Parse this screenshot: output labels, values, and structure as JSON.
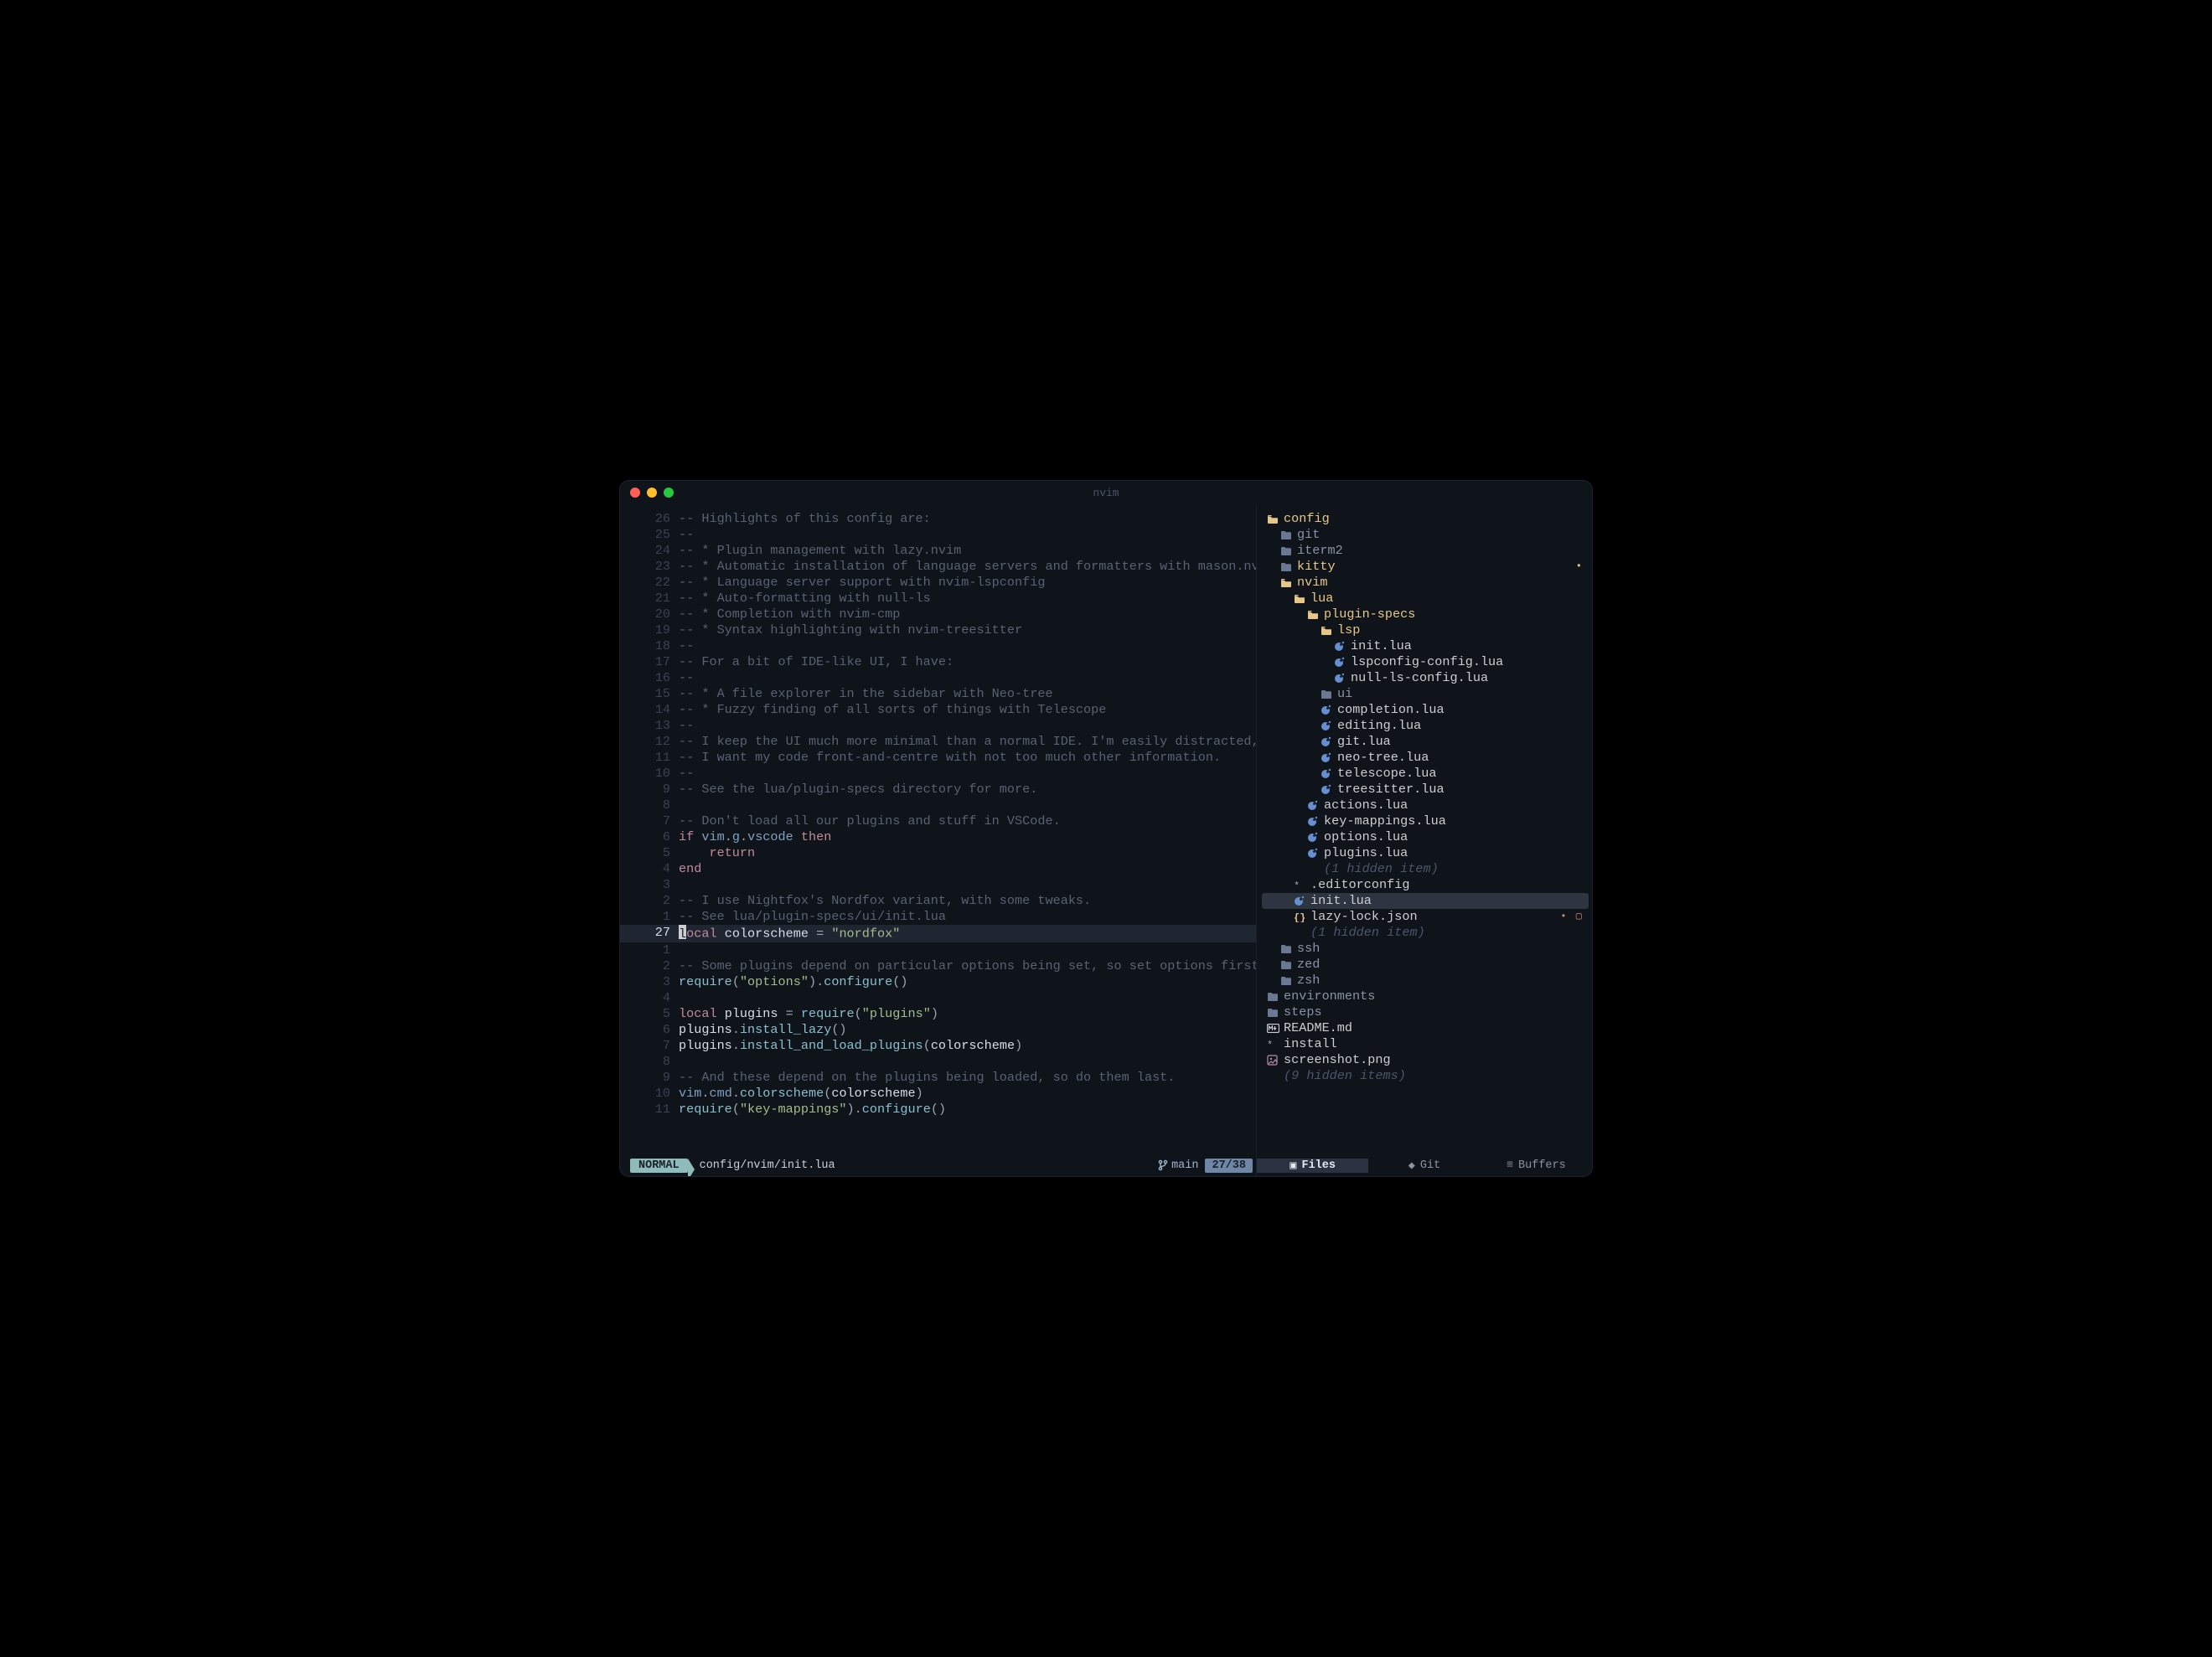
{
  "window": {
    "title": "nvim"
  },
  "editor": {
    "cursor_col_char": "l",
    "lines": [
      {
        "n": "26",
        "tokens": [
          [
            "comment",
            "-- Highlights of this config are:"
          ]
        ]
      },
      {
        "n": "25",
        "tokens": [
          [
            "comment",
            "--"
          ]
        ]
      },
      {
        "n": "24",
        "tokens": [
          [
            "comment",
            "-- * Plugin management with lazy.nvim"
          ]
        ]
      },
      {
        "n": "23",
        "tokens": [
          [
            "comment",
            "-- * Automatic installation of language servers and formatters with mason.nvim"
          ]
        ]
      },
      {
        "n": "22",
        "tokens": [
          [
            "comment",
            "-- * Language server support with nvim-lspconfig"
          ]
        ]
      },
      {
        "n": "21",
        "tokens": [
          [
            "comment",
            "-- * Auto-formatting with null-ls"
          ]
        ]
      },
      {
        "n": "20",
        "tokens": [
          [
            "comment",
            "-- * Completion with nvim-cmp"
          ]
        ]
      },
      {
        "n": "19",
        "tokens": [
          [
            "comment",
            "-- * Syntax highlighting with nvim-treesitter"
          ]
        ]
      },
      {
        "n": "18",
        "tokens": [
          [
            "comment",
            "--"
          ]
        ]
      },
      {
        "n": "17",
        "tokens": [
          [
            "comment",
            "-- For a bit of IDE-like UI, I have:"
          ]
        ]
      },
      {
        "n": "16",
        "tokens": [
          [
            "comment",
            "--"
          ]
        ]
      },
      {
        "n": "15",
        "tokens": [
          [
            "comment",
            "-- * A file explorer in the sidebar with Neo-tree"
          ]
        ]
      },
      {
        "n": "14",
        "tokens": [
          [
            "comment",
            "-- * Fuzzy finding of all sorts of things with Telescope"
          ]
        ]
      },
      {
        "n": "13",
        "tokens": [
          [
            "comment",
            "--"
          ]
        ]
      },
      {
        "n": "12",
        "tokens": [
          [
            "comment",
            "-- I keep the UI much more minimal than a normal IDE. I'm easily distracted, so"
          ]
        ]
      },
      {
        "n": "11",
        "tokens": [
          [
            "comment",
            "-- I want my code front-and-centre with not too much other information."
          ]
        ]
      },
      {
        "n": "10",
        "tokens": [
          [
            "comment",
            "--"
          ]
        ]
      },
      {
        "n": "9",
        "tokens": [
          [
            "comment",
            "-- See the lua/plugin-specs directory for more."
          ]
        ]
      },
      {
        "n": "8",
        "tokens": []
      },
      {
        "n": "7",
        "tokens": [
          [
            "comment",
            "-- Don't load all our plugins and stuff in VSCode."
          ]
        ]
      },
      {
        "n": "6",
        "tokens": [
          [
            "kw",
            "if"
          ],
          [
            "punc",
            " "
          ],
          [
            "fd",
            "vim"
          ],
          [
            "punc",
            "."
          ],
          [
            "fd",
            "g"
          ],
          [
            "punc",
            "."
          ],
          [
            "fd",
            "vscode"
          ],
          [
            "punc",
            " "
          ],
          [
            "kw",
            "then"
          ]
        ]
      },
      {
        "n": "5",
        "tokens": [
          [
            "punc",
            "    "
          ],
          [
            "kw",
            "return"
          ]
        ]
      },
      {
        "n": "4",
        "tokens": [
          [
            "kw",
            "end"
          ]
        ]
      },
      {
        "n": "3",
        "tokens": []
      },
      {
        "n": "2",
        "tokens": [
          [
            "comment",
            "-- I use Nightfox's Nordfox variant, with some tweaks."
          ]
        ]
      },
      {
        "n": "1",
        "tokens": [
          [
            "comment",
            "-- See lua/plugin-specs/ui/init.lua"
          ]
        ]
      },
      {
        "n": "27",
        "current": true,
        "cursor": true,
        "tokens": [
          [
            "kw",
            "ocal"
          ],
          [
            "punc",
            " "
          ],
          [
            "id",
            "colorscheme"
          ],
          [
            "punc",
            " = "
          ],
          [
            "str",
            "\"nordfox\""
          ]
        ]
      },
      {
        "n": "1",
        "tokens": []
      },
      {
        "n": "2",
        "tokens": [
          [
            "comment",
            "-- Some plugins depend on particular options being set, so set options first."
          ]
        ]
      },
      {
        "n": "3",
        "tokens": [
          [
            "fn",
            "require"
          ],
          [
            "punc",
            "("
          ],
          [
            "str",
            "\"options\""
          ],
          [
            "punc",
            ")."
          ],
          [
            "fn",
            "configure"
          ],
          [
            "punc",
            "()"
          ]
        ]
      },
      {
        "n": "4",
        "tokens": []
      },
      {
        "n": "5",
        "tokens": [
          [
            "kw",
            "local"
          ],
          [
            "punc",
            " "
          ],
          [
            "id",
            "plugins"
          ],
          [
            "punc",
            " = "
          ],
          [
            "fn",
            "require"
          ],
          [
            "punc",
            "("
          ],
          [
            "str",
            "\"plugins\""
          ],
          [
            "punc",
            ")"
          ]
        ]
      },
      {
        "n": "6",
        "tokens": [
          [
            "id",
            "plugins"
          ],
          [
            "punc",
            "."
          ],
          [
            "fn",
            "install_lazy"
          ],
          [
            "punc",
            "()"
          ]
        ]
      },
      {
        "n": "7",
        "tokens": [
          [
            "id",
            "plugins"
          ],
          [
            "punc",
            "."
          ],
          [
            "fn",
            "install_and_load_plugins"
          ],
          [
            "punc",
            "("
          ],
          [
            "id",
            "colorscheme"
          ],
          [
            "punc",
            ")"
          ]
        ]
      },
      {
        "n": "8",
        "tokens": []
      },
      {
        "n": "9",
        "tokens": [
          [
            "comment",
            "-- And these depend on the plugins being loaded, so do them last."
          ]
        ]
      },
      {
        "n": "10",
        "tokens": [
          [
            "fd",
            "vim"
          ],
          [
            "punc",
            "."
          ],
          [
            "fd",
            "cmd"
          ],
          [
            "punc",
            "."
          ],
          [
            "fn",
            "colorscheme"
          ],
          [
            "punc",
            "("
          ],
          [
            "id",
            "colorscheme"
          ],
          [
            "punc",
            ")"
          ]
        ]
      },
      {
        "n": "11",
        "tokens": [
          [
            "fn",
            "require"
          ],
          [
            "punc",
            "("
          ],
          [
            "str",
            "\"key-mappings\""
          ],
          [
            "punc",
            ")."
          ],
          [
            "fn",
            "configure"
          ],
          [
            "punc",
            "()"
          ]
        ]
      }
    ]
  },
  "status_left": {
    "mode": "NORMAL",
    "path": "config/nvim/init.lua",
    "branch_icon": "⎇",
    "branch": "main",
    "location": "27/38"
  },
  "tree": {
    "nodes": [
      {
        "depth": 0,
        "icon": "folder-open",
        "name": "config",
        "color": "folder-open"
      },
      {
        "depth": 1,
        "icon": "folder",
        "name": "git",
        "color": "folder"
      },
      {
        "depth": 1,
        "icon": "folder",
        "name": "iterm2",
        "color": "folder"
      },
      {
        "depth": 1,
        "icon": "folder",
        "name": "kitty",
        "color": "folder-open",
        "badge": "•",
        "badge_color": "#e7c787"
      },
      {
        "depth": 1,
        "icon": "folder-open",
        "name": "nvim",
        "color": "folder-open"
      },
      {
        "depth": 2,
        "icon": "folder-open",
        "name": "lua",
        "color": "folder-open"
      },
      {
        "depth": 3,
        "icon": "folder-open",
        "name": "plugin-specs",
        "color": "folder-open"
      },
      {
        "depth": 4,
        "icon": "folder-open",
        "name": "lsp",
        "color": "folder-open"
      },
      {
        "depth": 5,
        "icon": "lua",
        "name": "init.lua",
        "color": "lua"
      },
      {
        "depth": 5,
        "icon": "lua",
        "name": "lspconfig-config.lua",
        "color": "lua"
      },
      {
        "depth": 5,
        "icon": "lua",
        "name": "null-ls-config.lua",
        "color": "lua"
      },
      {
        "depth": 4,
        "icon": "folder",
        "name": "ui",
        "color": "folder"
      },
      {
        "depth": 4,
        "icon": "lua",
        "name": "completion.lua",
        "color": "lua"
      },
      {
        "depth": 4,
        "icon": "lua",
        "name": "editing.lua",
        "color": "lua"
      },
      {
        "depth": 4,
        "icon": "lua",
        "name": "git.lua",
        "color": "lua"
      },
      {
        "depth": 4,
        "icon": "lua",
        "name": "neo-tree.lua",
        "color": "lua"
      },
      {
        "depth": 4,
        "icon": "lua",
        "name": "telescope.lua",
        "color": "lua"
      },
      {
        "depth": 4,
        "icon": "lua",
        "name": "treesitter.lua",
        "color": "lua"
      },
      {
        "depth": 3,
        "icon": "lua",
        "name": "actions.lua",
        "color": "lua"
      },
      {
        "depth": 3,
        "icon": "lua",
        "name": "key-mappings.lua",
        "color": "lua"
      },
      {
        "depth": 3,
        "icon": "lua",
        "name": "options.lua",
        "color": "lua"
      },
      {
        "depth": 3,
        "icon": "lua",
        "name": "plugins.lua",
        "color": "lua"
      },
      {
        "depth": 3,
        "icon": "",
        "name": "(1 hidden item)",
        "color": "hidden"
      },
      {
        "depth": 2,
        "icon": "star",
        "name": ".editorconfig",
        "color": "star"
      },
      {
        "depth": 2,
        "icon": "lua",
        "name": "init.lua",
        "color": "lua",
        "selected": true
      },
      {
        "depth": 2,
        "icon": "json",
        "name": "lazy-lock.json",
        "color": "json",
        "badge": "• ▢",
        "badge_color": "#d08770"
      },
      {
        "depth": 2,
        "icon": "",
        "name": "(1 hidden item)",
        "color": "hidden"
      },
      {
        "depth": 1,
        "icon": "folder",
        "name": "ssh",
        "color": "folder"
      },
      {
        "depth": 1,
        "icon": "folder",
        "name": "zed",
        "color": "folder"
      },
      {
        "depth": 1,
        "icon": "folder",
        "name": "zsh",
        "color": "folder"
      },
      {
        "depth": 0,
        "icon": "folder",
        "name": "environments",
        "color": "folder"
      },
      {
        "depth": 0,
        "icon": "folder",
        "name": "steps",
        "color": "folder"
      },
      {
        "depth": 0,
        "icon": "md",
        "name": "README.md",
        "color": "md"
      },
      {
        "depth": 0,
        "icon": "star",
        "name": "install",
        "color": "star"
      },
      {
        "depth": 0,
        "icon": "png",
        "name": "screenshot.png",
        "color": "png"
      },
      {
        "depth": 0,
        "icon": "",
        "name": "(9 hidden items)",
        "color": "hidden"
      }
    ]
  },
  "status_right": {
    "tabs": [
      {
        "icon": "▣",
        "label": "Files",
        "active": true
      },
      {
        "icon": "◆",
        "label": "Git",
        "active": false
      },
      {
        "icon": "≡",
        "label": "Buffers",
        "active": false
      }
    ]
  }
}
